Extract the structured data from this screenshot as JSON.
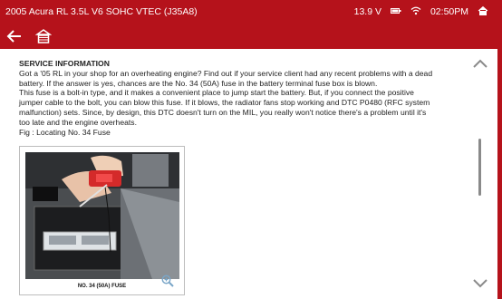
{
  "status_bar": {
    "vehicle": "2005 Acura RL 3.5L V6 SOHC VTEC (J35A8)",
    "voltage": "13.9 V",
    "time": "02:50PM",
    "icons": [
      "battery-icon",
      "wifi-icon",
      "home-icon"
    ]
  },
  "toolbar": {
    "icons": [
      "back-arrow-icon",
      "home-icon"
    ]
  },
  "article": {
    "heading": "SERVICE INFORMATION",
    "lines": [
      "Got a '05 RL in your shop for an overheating engine? Find out if your service client had any recent problems with a dead",
      "battery. If the answer is yes, chances are the No. 34 (50A) fuse in the battery terminal fuse box is blown.",
      "This fuse is a bolt-in type, and it makes a convenient place to jump start the battery. But, if you connect the positive",
      "jumper cable to the bolt, you can blow this fuse. If it blows, the radiator fans stop working and DTC P0480 (RFC system",
      "malfunction) sets. Since, by design, this DTC doesn't turn on the MIL, you really won't notice there's a problem until it's",
      "too late and the engine overheats.",
      "Fig : Locating No. 34 Fuse"
    ]
  },
  "figure": {
    "caption": "NO. 34 (50A) FUSE",
    "icon": "zoom-in-icon"
  },
  "scroll": {
    "up_icon": "chevron-up-icon",
    "down_icon": "chevron-down-icon"
  },
  "colors": {
    "brand": "#b5121b",
    "text": "#222222",
    "scroll_thumb": "#8a8a8a"
  }
}
